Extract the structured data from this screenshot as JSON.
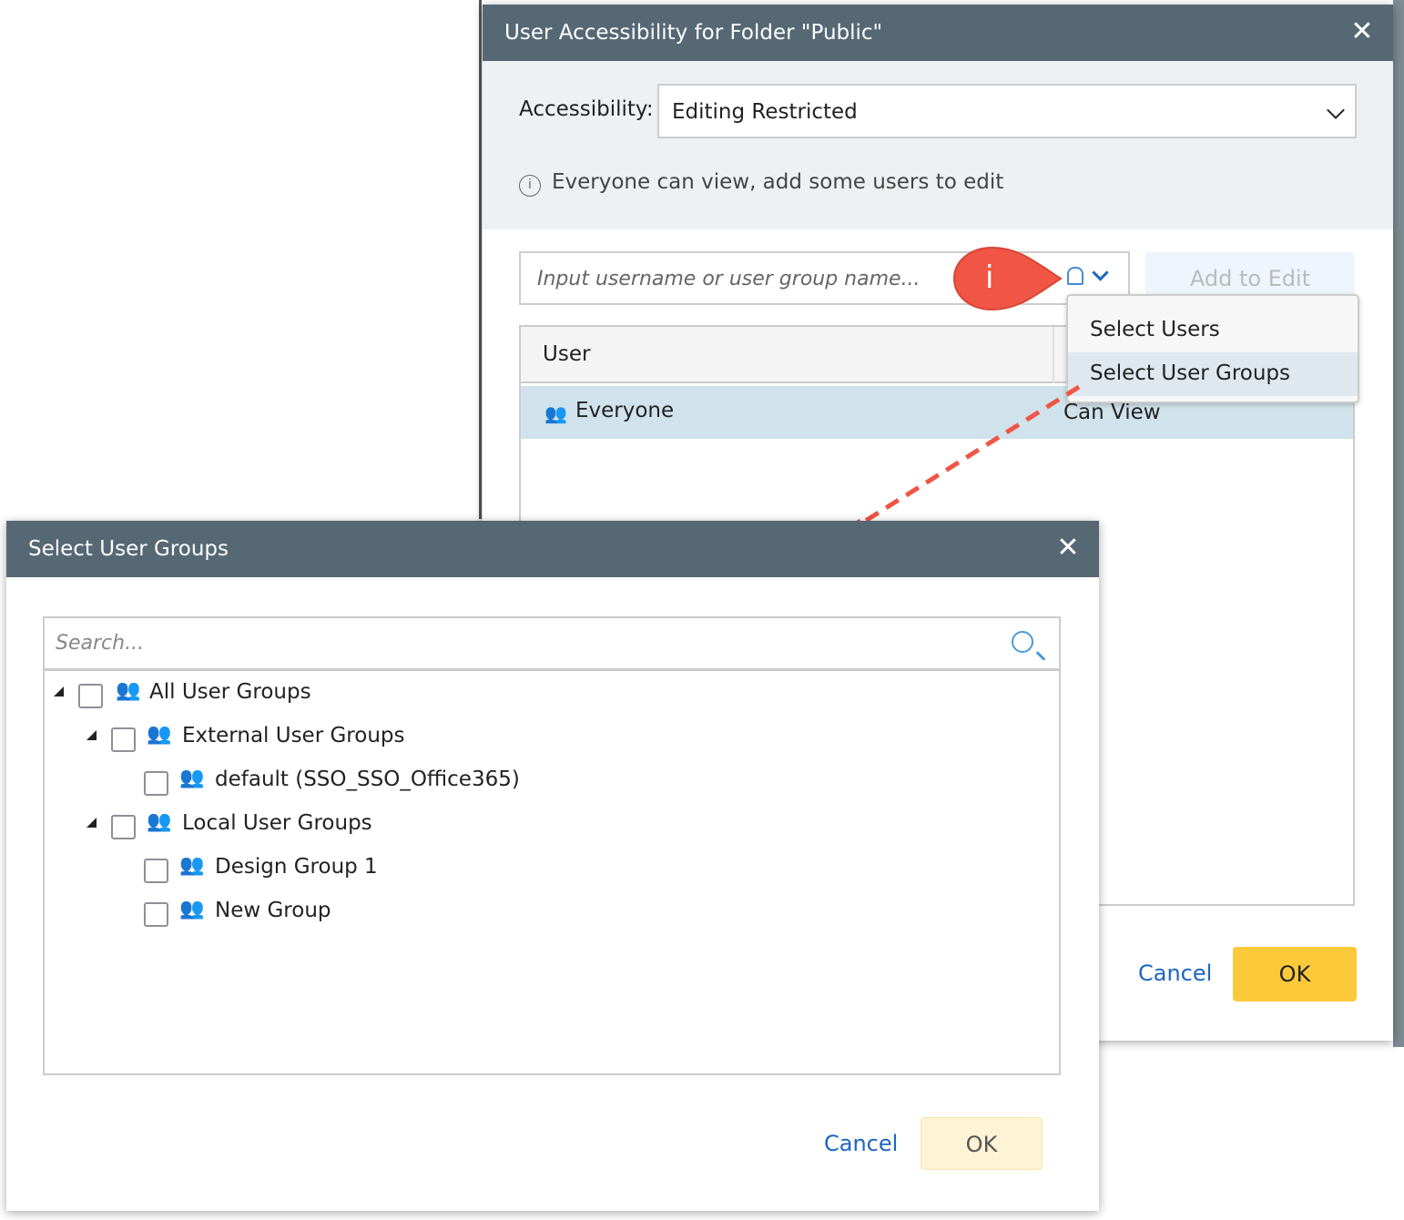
{
  "back_dialog": {
    "title": "User Accessibility for Folder \"Public\"",
    "accessibility_label": "Accessibility:",
    "accessibility_value": "Editing Restricted",
    "info_text": "Everyone can view, add some users to edit",
    "input_placeholder": "Input username or user group name...",
    "add_button": "Add to Edit",
    "table_header": "User",
    "rows": [
      {
        "name": "Everyone",
        "permission": "Can View"
      }
    ],
    "cancel": "Cancel",
    "ok": "OK"
  },
  "dropdown_menu": {
    "items": [
      "Select Users",
      "Select User Groups"
    ]
  },
  "callout": {
    "label": "i",
    "color": "#f05545"
  },
  "front_dialog": {
    "title": "Select User Groups",
    "search_placeholder": "Search...",
    "tree": [
      "All User Groups",
      "External User Groups",
      "default (SSO_SSO_Office365)",
      "Local User Groups",
      "Design Group 1",
      "New Group"
    ],
    "cancel": "Cancel",
    "ok": "OK"
  }
}
